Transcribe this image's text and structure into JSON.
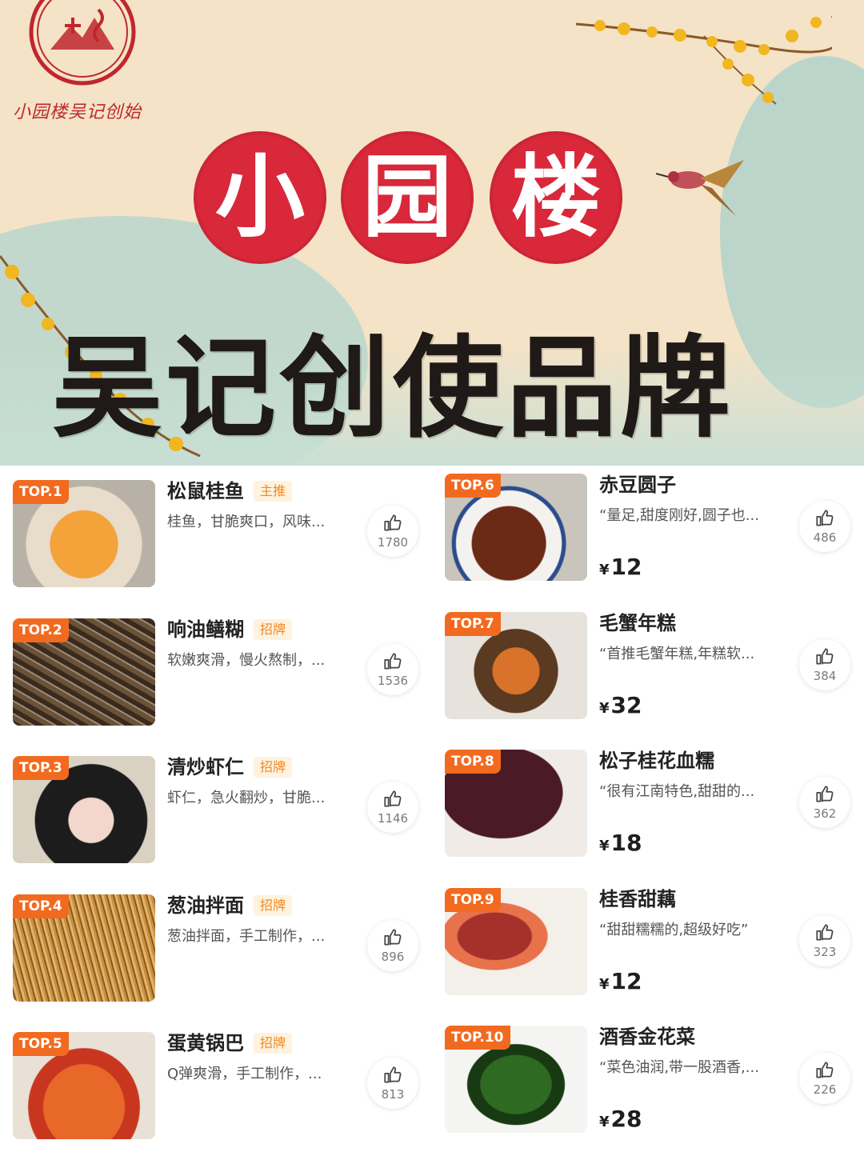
{
  "banner": {
    "seal_text": "小园楼",
    "seal_caption": "小园楼吴记创始",
    "title_chars": [
      "小",
      "园",
      "楼"
    ],
    "subtitle": "吴记创使品牌",
    "colors": {
      "red": "#d8283a",
      "cream": "#f4e3c6",
      "teal": "#b9d6cc"
    }
  },
  "left_list": [
    {
      "rank": "TOP.1",
      "name": "松鼠桂鱼",
      "tag": "主推",
      "desc": "桂鱼，甘脆爽口，风味...",
      "likes": "1780",
      "image_icon": "squirrel-fish-photo"
    },
    {
      "rank": "TOP.2",
      "name": "响油鳝糊",
      "tag": "招牌",
      "desc": "软嫩爽滑，慢火熬制，...",
      "likes": "1536",
      "image_icon": "eel-photo"
    },
    {
      "rank": "TOP.3",
      "name": "清炒虾仁",
      "tag": "招牌",
      "desc": "虾仁，急火翻炒，甘脆...",
      "likes": "1146",
      "image_icon": "shrimp-photo"
    },
    {
      "rank": "TOP.4",
      "name": "葱油拌面",
      "tag": "招牌",
      "desc": "葱油拌面，手工制作，...",
      "likes": "896",
      "image_icon": "noodles-photo"
    },
    {
      "rank": "TOP.5",
      "name": "蛋黄锅巴",
      "tag": "招牌",
      "desc": "Q弹爽滑，手工制作，...",
      "likes": "813",
      "image_icon": "rice-crust-photo"
    }
  ],
  "right_list": [
    {
      "rank": "TOP.6",
      "name": "赤豆圆子",
      "desc": "“量足,甜度刚好,圆子也...",
      "price": "12",
      "likes": "486",
      "image_icon": "red-bean-soup-photo"
    },
    {
      "rank": "TOP.7",
      "name": "毛蟹年糕",
      "desc": "“首推毛蟹年糕,年糕软...",
      "price": "32",
      "likes": "384",
      "image_icon": "crab-ricecake-photo"
    },
    {
      "rank": "TOP.8",
      "name": "松子桂花血糯",
      "desc": "“很有江南特色,甜甜的...",
      "price": "18",
      "likes": "362",
      "image_icon": "black-rice-photo"
    },
    {
      "rank": "TOP.9",
      "name": "桂香甜藕",
      "desc": "“甜甜糯糯的,超级好吃”",
      "price": "12",
      "likes": "323",
      "image_icon": "lotus-root-photo"
    },
    {
      "rank": "TOP.10",
      "name": "酒香金花菜",
      "desc": "“菜色油润,带一股酒香,...",
      "price": "28",
      "likes": "226",
      "image_icon": "greens-photo"
    }
  ],
  "currency_symbol": "¥",
  "like_icon": "thumbs-up-icon",
  "accent": "#f26a1f"
}
